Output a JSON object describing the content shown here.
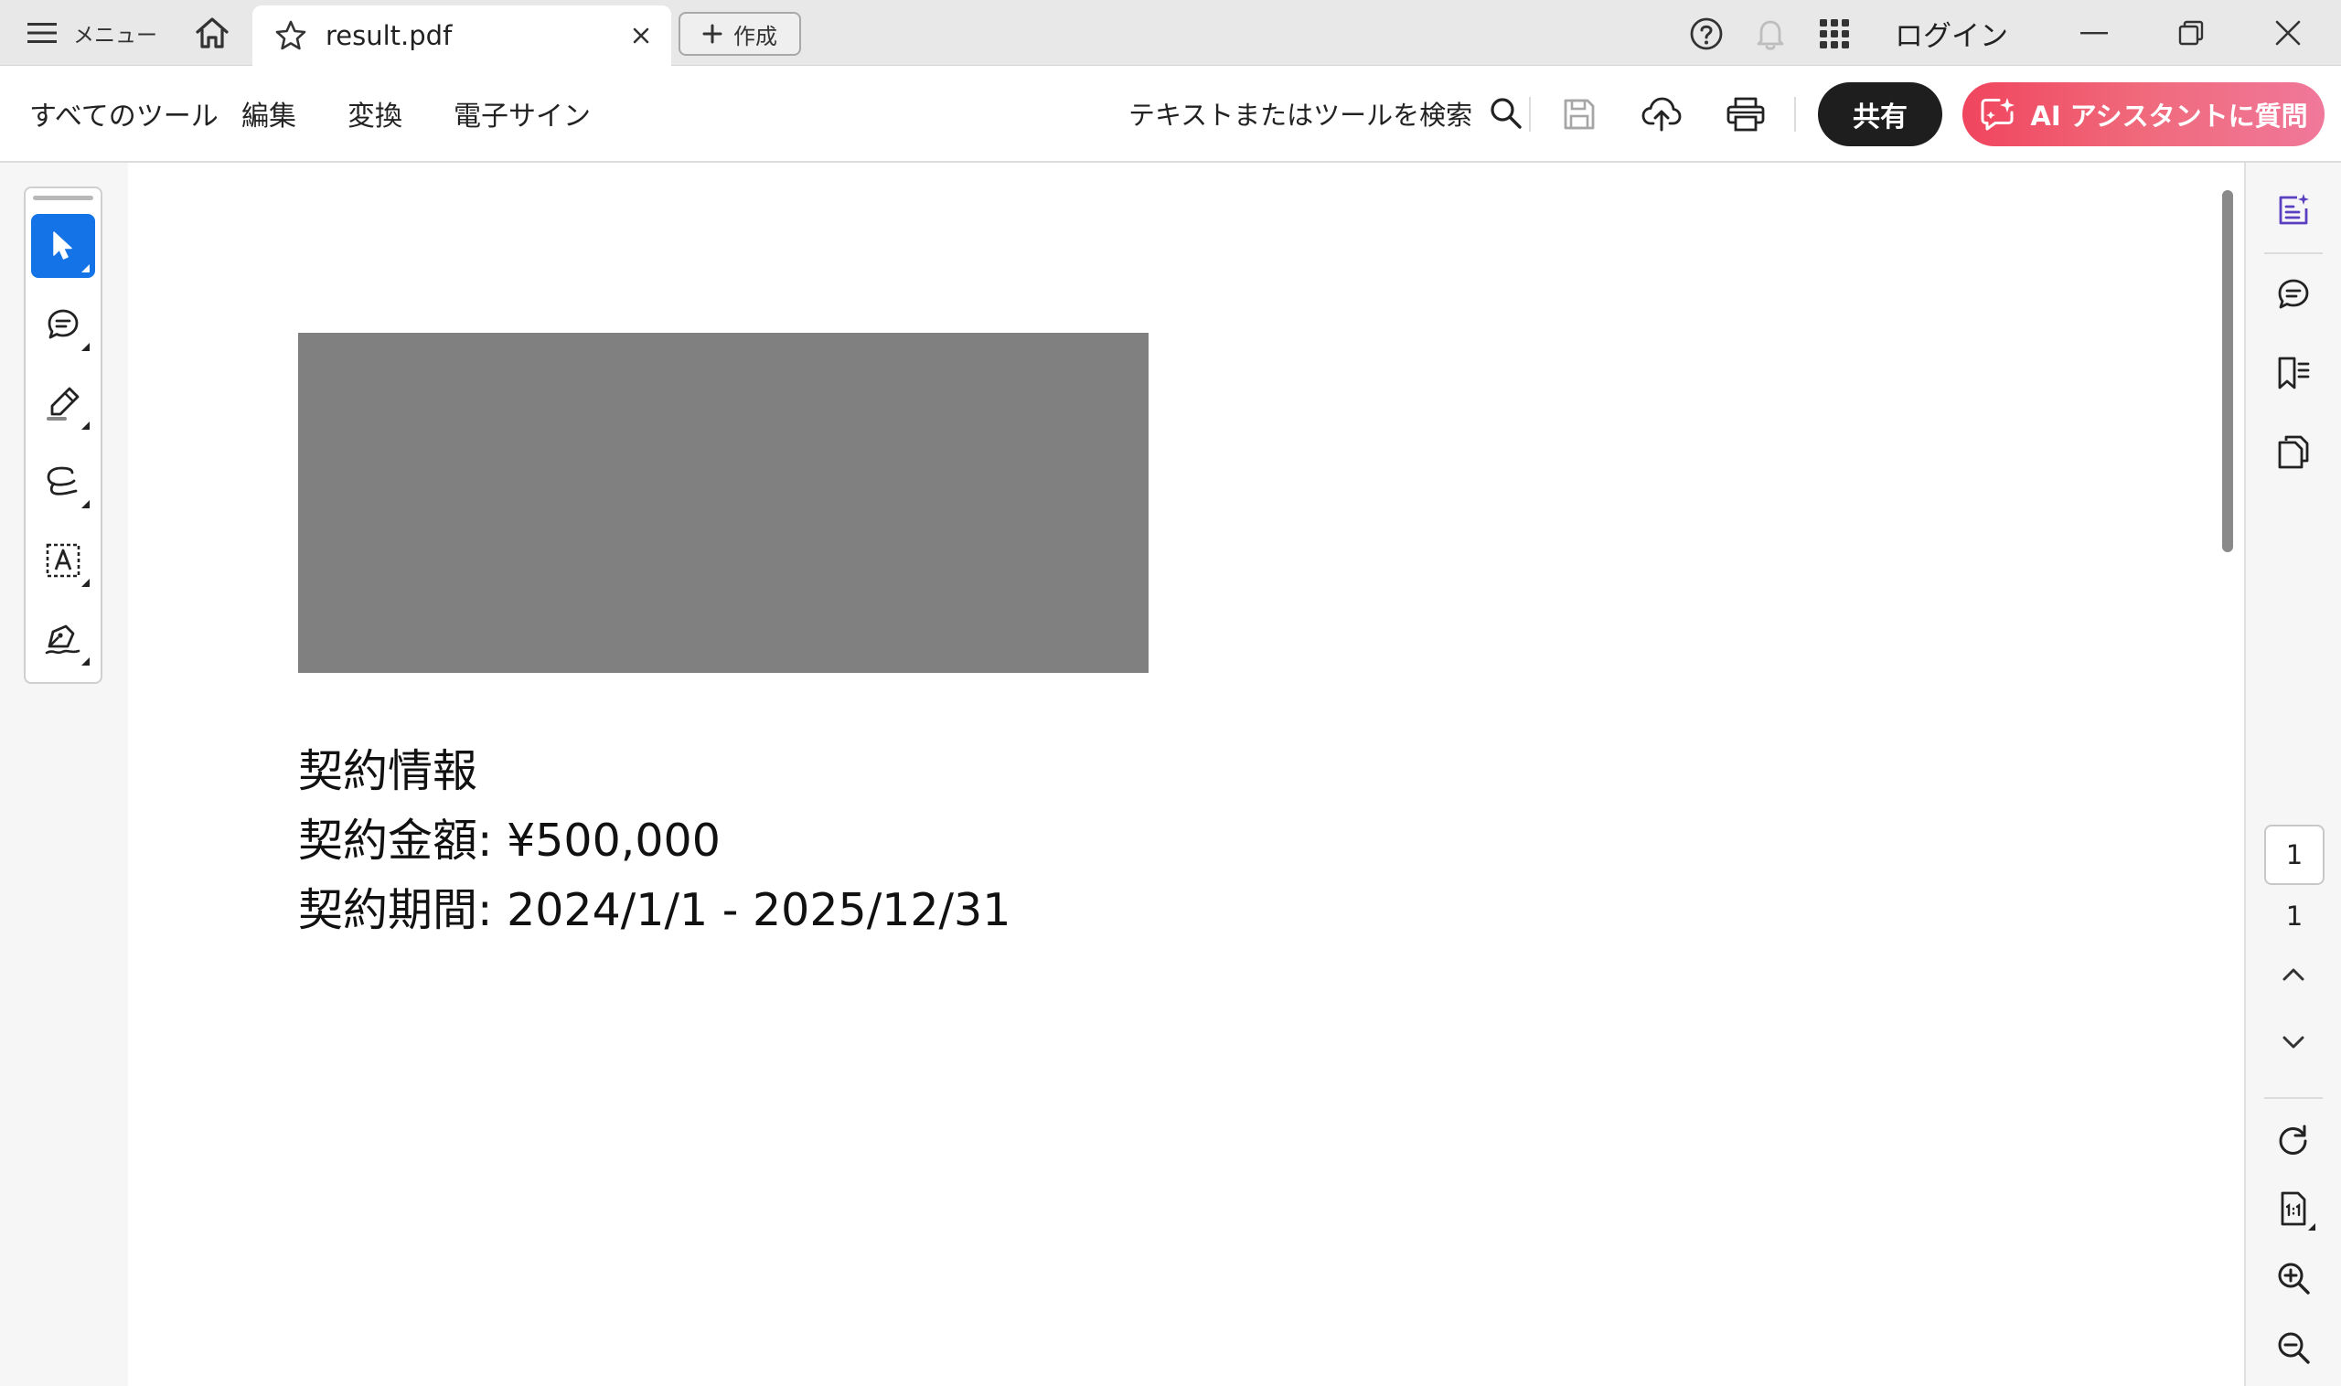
{
  "titlebar": {
    "menu_label": "メニュー",
    "tab_title": "result.pdf",
    "create_label": "作成",
    "login_label": "ログイン"
  },
  "toolbar": {
    "menu_items": [
      "すべてのツール",
      "編集",
      "変換",
      "電子サイン"
    ],
    "search_label": "テキストまたはツールを検索",
    "share_label": "共有",
    "ai_label": "AI アシスタントに質問"
  },
  "document": {
    "lines": [
      "契約情報",
      "契約金額: ¥500,000",
      "契約期間: 2024/1/1 - 2025/12/31"
    ]
  },
  "page_nav": {
    "current_page": "1",
    "total_pages": "1"
  },
  "colors": {
    "accent": "#1473e6",
    "ai_gradient_start": "#f0455e",
    "ai_gradient_end": "#f0789a",
    "share_bg": "#1e1e1e",
    "redaction": "#808080"
  },
  "icons": {
    "titlebar": [
      "hamburger-icon",
      "home-icon",
      "star-icon",
      "close-icon",
      "plus-icon",
      "help-icon",
      "bell-icon",
      "apps-grid-icon",
      "minimize-icon",
      "restore-icon",
      "window-close-icon"
    ],
    "toolbar": [
      "search-icon",
      "save-icon",
      "cloud-upload-icon",
      "print-icon",
      "ai-sparkle-icon"
    ],
    "tools": [
      "select-cursor-icon",
      "comment-icon",
      "highlighter-icon",
      "lasso-draw-icon",
      "text-box-icon",
      "sign-pen-icon"
    ],
    "right_rail": [
      "ai-summary-icon",
      "comments-panel-icon",
      "bookmarks-icon",
      "pages-icon",
      "chevron-up-icon",
      "chevron-down-icon",
      "rotate-icon",
      "actual-size-icon",
      "zoom-in-icon",
      "zoom-out-icon"
    ]
  }
}
